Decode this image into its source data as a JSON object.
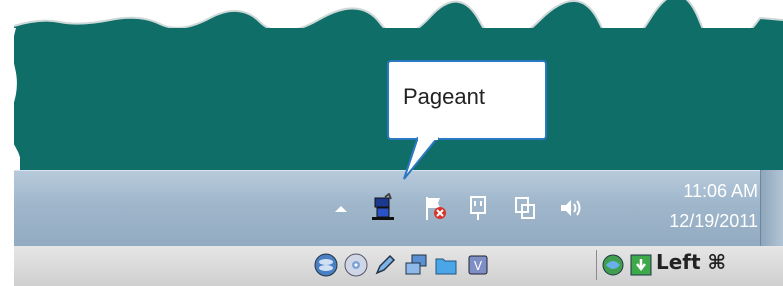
{
  "tooltip": {
    "text": "Pageant"
  },
  "tray": {
    "icons": [
      {
        "name": "show-hidden-icons-icon"
      },
      {
        "name": "pageant-icon"
      },
      {
        "name": "action-center-flag-icon"
      },
      {
        "name": "power-plug-icon"
      },
      {
        "name": "network-icon"
      },
      {
        "name": "volume-icon"
      }
    ]
  },
  "clock": {
    "time": "11:06 AM",
    "date": "12/19/2011"
  },
  "bottom_bar": {
    "icons": [
      {
        "name": "disk-utility-icon"
      },
      {
        "name": "dvd-icon"
      },
      {
        "name": "pen-tool-icon"
      },
      {
        "name": "windows-switch-icon"
      },
      {
        "name": "folder-icon"
      },
      {
        "name": "vm-chip-icon"
      },
      {
        "name": "globe-sync-icon"
      },
      {
        "name": "green-download-icon"
      }
    ],
    "keyboard_label": "Left ⌘"
  },
  "colors": {
    "desktop": "#0f6f68",
    "tooltip_border": "#2a78c2",
    "taskbar": "#9fb6cb"
  }
}
